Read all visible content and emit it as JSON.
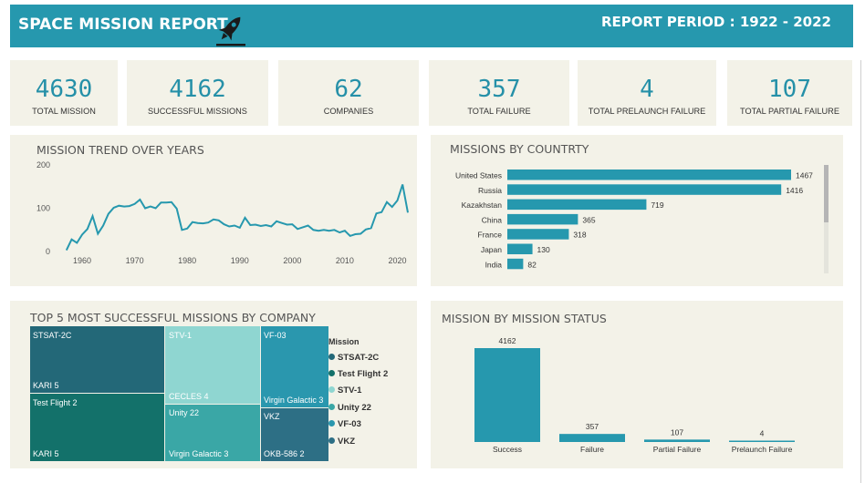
{
  "header": {
    "title": "SPACE MISSION REPORT",
    "period": "REPORT PERIOD : 1922 - 2022",
    "icon": "rocket-icon"
  },
  "kpis": [
    {
      "value": "4630",
      "label": "TOTAL MISSION"
    },
    {
      "value": "4162",
      "label": "SUCCESSFUL MISSIONS"
    },
    {
      "value": "62",
      "label": "COMPANIES"
    },
    {
      "value": "357",
      "label": "TOTAL FAILURE"
    },
    {
      "value": "4",
      "label": "TOTAL PRELAUNCH FAILURE"
    },
    {
      "value": "107",
      "label": "TOTAL PARTIAL FAILURE"
    }
  ],
  "colors": {
    "accent": "#2698ae",
    "panel_bg": "#f3f2e8",
    "kpi_text": "#2590a8",
    "treemap": [
      "#236878",
      "#13716a",
      "#8fd6d1",
      "#3aa7a6",
      "#2a97ae",
      "#2d6f85"
    ]
  },
  "panels": {
    "trend_title": "MISSION TREND OVER YEARS",
    "country_title": "MISSIONS BY COUNTRTY",
    "treemap_title": "TOP 5 MOST SUCCESSFUL MISSIONS BY COMPANY",
    "status_title": "MISSION BY MISSION STATUS"
  },
  "chart_data": [
    {
      "type": "line",
      "title": "MISSION TREND OVER YEARS",
      "xlim": [
        1956,
        2022
      ],
      "ylim": [
        0,
        200
      ],
      "xticks": [
        1960,
        1970,
        1980,
        1990,
        2000,
        2010,
        2020
      ],
      "yticks": [
        0,
        100,
        200
      ],
      "x": [
        1957,
        1958,
        1959,
        1960,
        1961,
        1962,
        1963,
        1964,
        1965,
        1966,
        1967,
        1968,
        1969,
        1970,
        1971,
        1972,
        1973,
        1974,
        1975,
        1976,
        1977,
        1978,
        1979,
        1980,
        1981,
        1982,
        1983,
        1984,
        1985,
        1986,
        1987,
        1988,
        1989,
        1990,
        1991,
        1992,
        1993,
        1994,
        1995,
        1996,
        1997,
        1998,
        1999,
        2000,
        2001,
        2002,
        2003,
        2004,
        2005,
        2006,
        2007,
        2008,
        2009,
        2010,
        2011,
        2012,
        2013,
        2014,
        2015,
        2016,
        2017,
        2018,
        2019,
        2020,
        2021,
        2022
      ],
      "y": [
        3,
        28,
        20,
        39,
        52,
        82,
        41,
        60,
        87,
        101,
        106,
        104,
        105,
        110,
        120,
        100,
        104,
        100,
        113,
        113,
        114,
        99,
        50,
        53,
        68,
        66,
        65,
        67,
        74,
        72,
        63,
        58,
        60,
        55,
        78,
        61,
        62,
        59,
        61,
        58,
        70,
        66,
        62,
        63,
        52,
        56,
        60,
        50,
        48,
        50,
        48,
        50,
        44,
        48,
        36,
        40,
        41,
        51,
        54,
        88,
        91,
        114,
        103,
        118,
        155,
        90
      ]
    },
    {
      "type": "bar",
      "orientation": "horizontal",
      "title": "MISSIONS BY COUNTRTY",
      "categories": [
        "United States",
        "Russia",
        "Kazakhstan",
        "China",
        "France",
        "Japan",
        "India"
      ],
      "values": [
        1467,
        1416,
        719,
        365,
        318,
        130,
        82
      ]
    },
    {
      "type": "treemap",
      "title": "TOP 5 MOST SUCCESSFUL MISSIONS BY COMPANY",
      "legend_title": "Mission",
      "legend": [
        "STSAT-2C",
        "Test Flight 2",
        "STV-1",
        "Unity 22",
        "VF-03",
        "VKZ"
      ],
      "cells": [
        {
          "mission": "STSAT-2C",
          "company": "KARI 5"
        },
        {
          "mission": "Test Flight 2",
          "company": "KARI 5"
        },
        {
          "mission": "STV-1",
          "company": "CECLES 4"
        },
        {
          "mission": "Unity 22",
          "company": "Virgin Galactic 3"
        },
        {
          "mission": "VF-03",
          "company": "Virgin Galactic 3"
        },
        {
          "mission": "VKZ",
          "company": "OKB-586 2"
        }
      ]
    },
    {
      "type": "bar",
      "title": "MISSION BY MISSION STATUS",
      "categories": [
        "Success",
        "Failure",
        "Partial Failure",
        "Prelaunch Failure"
      ],
      "values": [
        4162,
        357,
        107,
        4
      ]
    }
  ]
}
